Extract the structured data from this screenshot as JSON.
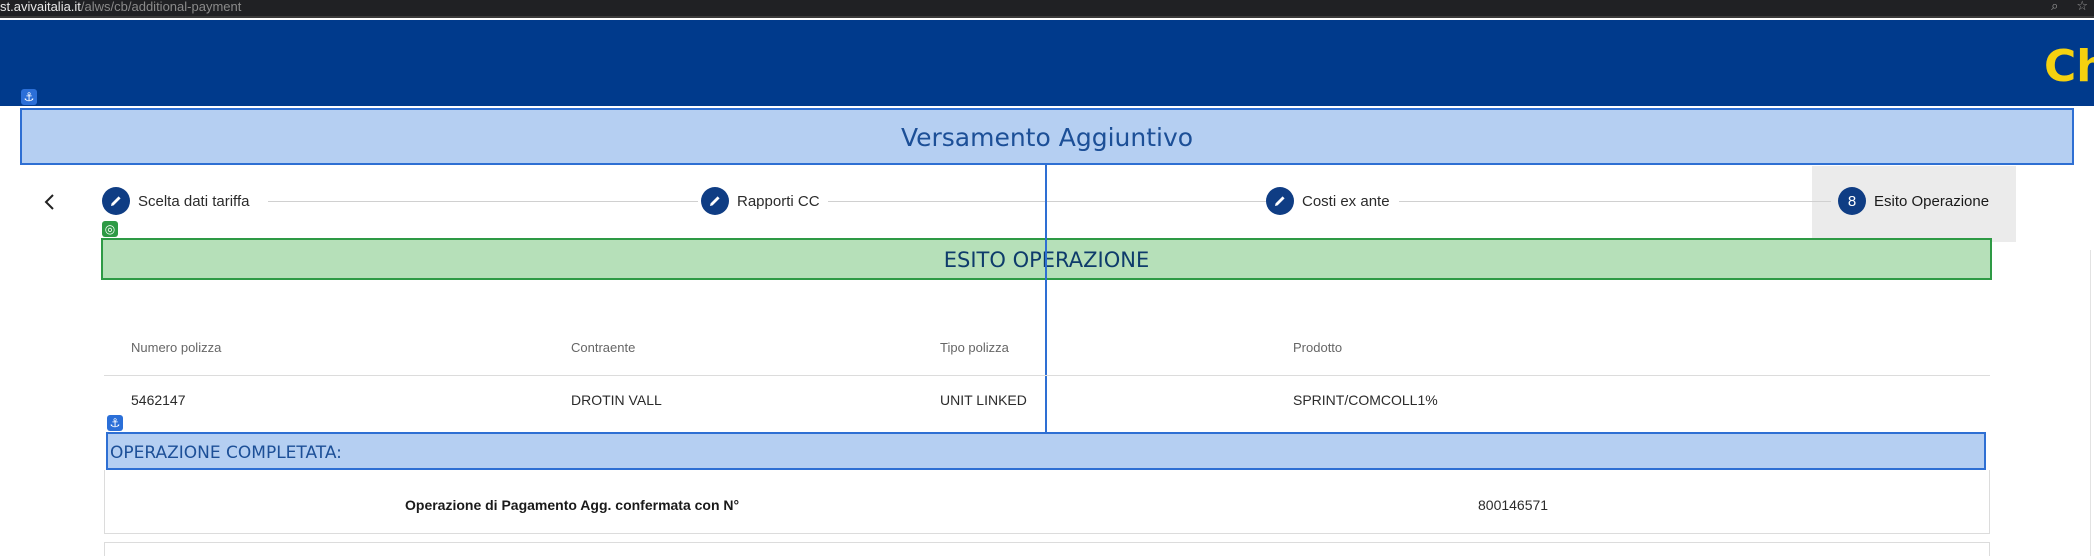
{
  "browser": {
    "url_host": "st.avivaitalia.it",
    "url_path": "/alws/cb/additional-payment"
  },
  "header": {
    "brand_text": "Ch"
  },
  "page": {
    "title": "Versamento Aggiuntivo"
  },
  "stepper": {
    "steps": [
      {
        "label": "Scelta dati tariffa",
        "icon": "pencil-icon",
        "state": "completed"
      },
      {
        "label": "Rapporti CC",
        "icon": "pencil-icon",
        "state": "completed"
      },
      {
        "label": "Costi ex ante",
        "icon": "pencil-icon",
        "state": "completed"
      },
      {
        "label": "Esito Operazione",
        "number": "8",
        "state": "active"
      }
    ]
  },
  "section": {
    "title": "ESITO OPERAZIONE"
  },
  "policy_table": {
    "headers": [
      "Numero polizza",
      "Contraente",
      "Tipo polizza",
      "Prodotto"
    ],
    "row": [
      "5462147",
      "DROTIN VALL",
      "UNIT LINKED",
      "SPRINT/COMCOLL1%"
    ]
  },
  "result": {
    "status": "OPERAZIONE COMPLETATA:",
    "confirm_label": "Operazione di Pagamento Agg. confermata con N°",
    "confirm_number": "800146571"
  },
  "colors": {
    "header_bg": "#003a8c",
    "brand": "#f5d10f",
    "step_circle": "#0f3d84",
    "highlight_blue": "#b5cff2",
    "highlight_green": "#b6e0b9"
  }
}
